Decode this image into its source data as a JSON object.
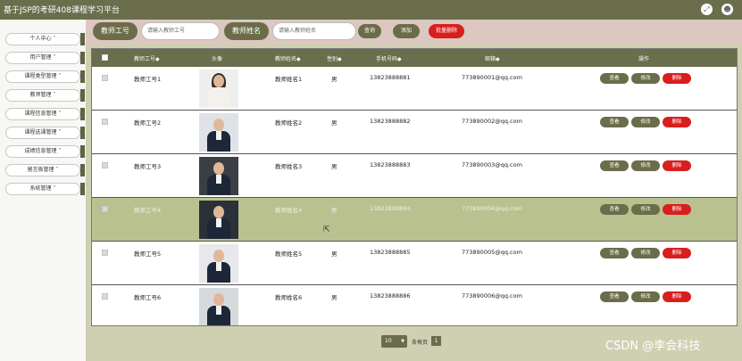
{
  "app": {
    "title": "基于JSP的考研408课程学习平台",
    "icons": [
      "expand-icon",
      "user-icon"
    ]
  },
  "sidebar": {
    "items": [
      {
        "label": "个人中心 ˅"
      },
      {
        "label": "用户管理 ˅"
      },
      {
        "label": "课程类型管理 ˅"
      },
      {
        "label": "教师管理 ˅"
      },
      {
        "label": "课程信息管理 ˅"
      },
      {
        "label": "课程选课管理 ˅"
      },
      {
        "label": "成绩信息管理 ˅"
      },
      {
        "label": "留言板管理 ˅"
      },
      {
        "label": "系统管理 ˅"
      }
    ]
  },
  "search": {
    "label_id": "教师工号",
    "placeholder_id": "请输入教师工号",
    "label_name": "教师姓名",
    "placeholder_name": "请输入教师姓名",
    "query_btn": "查询",
    "add_btn": "添加",
    "batch_delete_btn": "批量删除"
  },
  "table": {
    "columns": [
      "教师工号◆",
      "头像",
      "教师姓名◆",
      "性别◆",
      "手机号码◆",
      "邮箱◆",
      "操作"
    ],
    "rows": [
      {
        "id": "教师工号1",
        "name": "教师姓名1",
        "gender": "男",
        "phone": "13823888881",
        "email": "773890001@qq.com",
        "photo": "female-portrait"
      },
      {
        "id": "教师工号2",
        "name": "教师姓名2",
        "gender": "男",
        "phone": "13823888882",
        "email": "773890002@qq.com",
        "photo": "male-portrait"
      },
      {
        "id": "教师工号3",
        "name": "教师姓名3",
        "gender": "男",
        "phone": "13823888883",
        "email": "773890003@qq.com",
        "photo": "male-portrait"
      },
      {
        "id": "教师工号4",
        "name": "教师姓名4",
        "gender": "男",
        "phone": "13823888884",
        "email": "773890004@qq.com",
        "photo": "male-portrait",
        "highlighted": true
      },
      {
        "id": "教师工号5",
        "name": "教师姓名5",
        "gender": "男",
        "phone": "13823888885",
        "email": "773890005@qq.com",
        "photo": "male-portrait"
      },
      {
        "id": "教师工号6",
        "name": "教师姓名6",
        "gender": "男",
        "phone": "13823888886",
        "email": "773890006@qq.com",
        "photo": "male-portrait"
      }
    ],
    "actions": {
      "view": "查看",
      "edit": "修改",
      "delete": "删除"
    }
  },
  "pager": {
    "page_size": "10",
    "per_page_text": "条每页",
    "current_page": "1"
  },
  "watermark": "CSDN @李会科技",
  "colors": {
    "primary": "#6a6e4c",
    "danger": "#d91e1e",
    "highlight_row": "#b9c28f",
    "search_bg": "#dcc8c0"
  }
}
